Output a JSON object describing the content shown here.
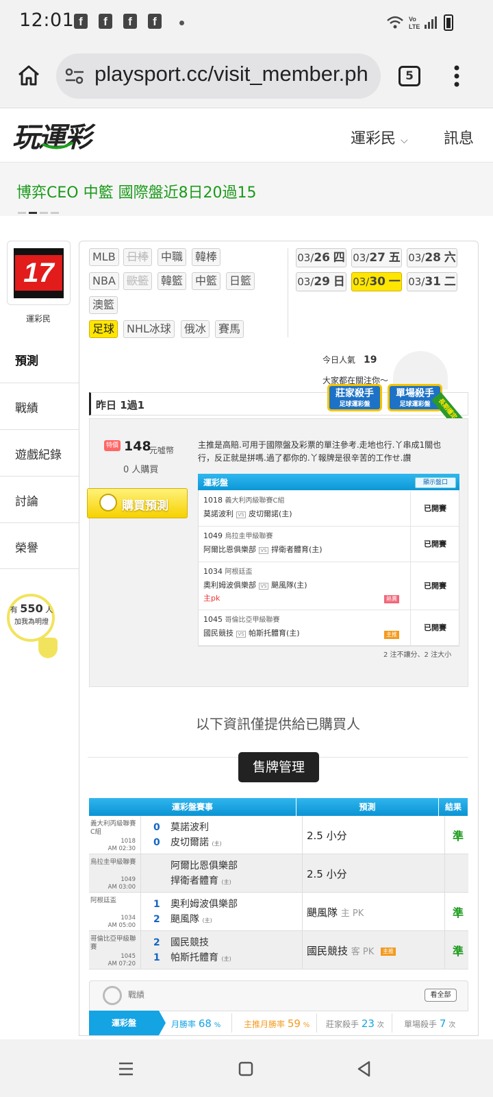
{
  "status_bar": {
    "time": "12:01",
    "network": "Vo LTE"
  },
  "browser": {
    "url": "playsport.cc/visit_member.ph",
    "tab_count": "5"
  },
  "site": {
    "logo": "玩運彩",
    "nav_member": "運彩民",
    "nav_msg": "訊息"
  },
  "banner": {
    "text": "博弈CEO 中籃 國際盤近8日20過15"
  },
  "profile": {
    "avatar_text": "17",
    "label": "運彩民"
  },
  "side_menu": [
    "預測",
    "戰績",
    "遊戲紀錄",
    "討論",
    "榮譽"
  ],
  "bulb": {
    "prefix": "有",
    "count": "550",
    "suffix": "人",
    "sub": "加我為明燈"
  },
  "leagues": [
    {
      "label": "MLB",
      "state": "normal"
    },
    {
      "label": "日棒",
      "state": "disabled"
    },
    {
      "label": "中職",
      "state": "normal"
    },
    {
      "label": "韓棒",
      "state": "normal"
    },
    {
      "label": "NBA",
      "state": "normal"
    },
    {
      "label": "歐籃",
      "state": "disabled"
    },
    {
      "label": "韓籃",
      "state": "normal"
    },
    {
      "label": "中籃",
      "state": "normal"
    },
    {
      "label": "日籃",
      "state": "normal"
    },
    {
      "label": "澳籃",
      "state": "normal"
    },
    {
      "label": "足球",
      "state": "active"
    },
    {
      "label": "NHL冰球",
      "state": "normal"
    },
    {
      "label": "俄冰",
      "state": "normal"
    },
    {
      "label": "賽馬",
      "state": "normal"
    }
  ],
  "dates": [
    {
      "md": "03/",
      "d": "26",
      "w": "四",
      "active": false
    },
    {
      "md": "03/",
      "d": "27",
      "w": "五",
      "active": false
    },
    {
      "md": "03/",
      "d": "28",
      "w": "六",
      "active": false
    },
    {
      "md": "03/",
      "d": "29",
      "w": "日",
      "active": false
    },
    {
      "md": "03/",
      "d": "30",
      "w": "一",
      "active": true
    },
    {
      "md": "03/",
      "d": "31",
      "w": "二",
      "active": false
    }
  ],
  "popularity": {
    "label": "今日人氣",
    "value": "19",
    "attention": "大家都在關注你～"
  },
  "yesterday": "昨日 1過1",
  "badges": [
    {
      "title": "莊家殺手",
      "sub": "足球運彩盤"
    },
    {
      "title": "單場殺手",
      "sub": "足球運彩盤"
    }
  ],
  "ribbon": "長期穩定",
  "sale": {
    "hot": "特價",
    "price": "148",
    "unit": "元噓幣",
    "buyers": "0 人購買",
    "buy_button": "購買預測"
  },
  "description": "主推是高賠.可用于國際盤及彩票的單注參考.走地也行.丫串成1關也行，反正就是拼嗎.過了都你的.丫報牌是很辛苦的工作せ.讚",
  "prediction_table": {
    "header": "運彩盤",
    "show_button": "顯示盤口",
    "rows": [
      {
        "no": "1018",
        "league": "義大利丙級聯賽C組",
        "home": "莫諾波利",
        "away": "皮切爾諾(主)",
        "status": "已開賽",
        "note": "",
        "chip": ""
      },
      {
        "no": "1049",
        "league": "烏拉圭甲級聯賽",
        "home": "阿爾比恩俱樂部",
        "away": "捍衛者體育(主)",
        "status": "已開賽",
        "note": "",
        "chip": ""
      },
      {
        "no": "1034",
        "league": "阿根廷盃",
        "home": "奧利姆波俱樂部",
        "away": "颶風隊(主)",
        "status": "已開賽",
        "note": "主pk",
        "chip": "熱賣"
      },
      {
        "no": "1045",
        "league": "哥倫比亞甲級聯賽",
        "home": "國民競技",
        "away": "帕斯托體育(主)",
        "status": "已開賽",
        "note": "",
        "chip": "主推"
      }
    ],
    "footer": "2 注不讓分、2 注大小"
  },
  "buyers_only": "以下資訊僅提供給已購買人",
  "management_button": "售牌管理",
  "results": {
    "headers": [
      "運彩盤賽事",
      "預測",
      "結果"
    ],
    "rows": [
      {
        "league": "義大利丙級聯賽C組",
        "no": "1018",
        "time": "AM 02:30",
        "score1": "0",
        "score2": "0",
        "team1": "莫諾波利",
        "team2": "皮切爾諾",
        "pred": "2.5 小分",
        "pred_note": "",
        "result": "準"
      },
      {
        "league": "烏拉圭甲級聯賽",
        "no": "1049",
        "time": "AM 03:00",
        "score1": "",
        "score2": "",
        "team1": "阿爾比恩俱樂部",
        "team2": "捍衛者體育",
        "pred": "2.5 小分",
        "pred_note": "",
        "result": ""
      },
      {
        "league": "阿根廷盃",
        "no": "1034",
        "time": "AM 05:00",
        "score1": "1",
        "score2": "2",
        "team1": "奧利姆波俱樂部",
        "team2": "颶風隊",
        "pred": "颶風隊",
        "pred_note": "主 PK",
        "result": "準"
      },
      {
        "league": "哥倫比亞甲級聯賽",
        "no": "1045",
        "time": "AM 07:20",
        "score1": "2",
        "score2": "1",
        "team1": "國民競技",
        "team2": "帕斯托體育",
        "pred": "國民競技",
        "pred_note": "客 PK",
        "result": "準"
      }
    ],
    "home_mark": "(主)",
    "chip": "主推"
  },
  "record": {
    "title": "戰績",
    "view_all": "看全部",
    "tab": "運彩盤",
    "stats": [
      {
        "label": "月勝率",
        "value": "68",
        "unit": "%"
      },
      {
        "label": "主推月勝率",
        "value": "59",
        "unit": "%"
      },
      {
        "label": "莊家殺手",
        "value": "23",
        "unit": "次"
      },
      {
        "label": "單場殺手",
        "value": "7",
        "unit": "次"
      }
    ]
  },
  "colors": {
    "accent_blue": "#14a3e3",
    "highlight_yellow": "#ffe600",
    "win_green": "#1a9a1a",
    "banner_green": "#1a9a1a"
  }
}
